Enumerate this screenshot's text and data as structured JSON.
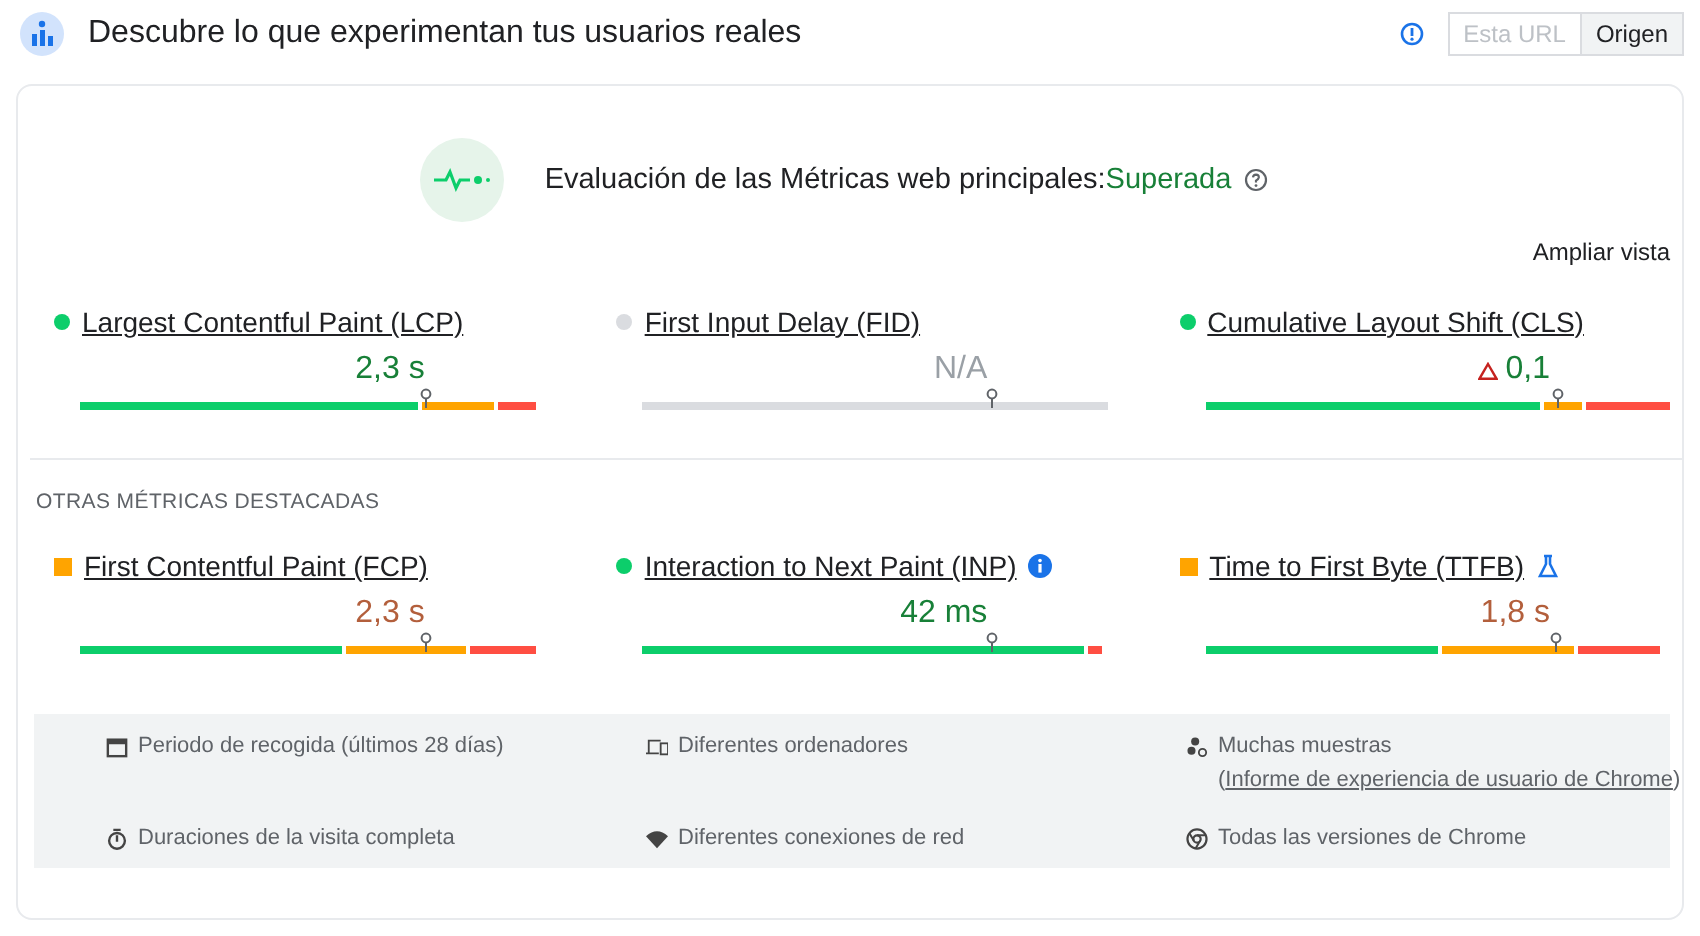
{
  "header": {
    "title": "Descubre lo que experimentan tus usuarios reales",
    "toggle": [
      {
        "label": "Esta URL",
        "selected": false
      },
      {
        "label": "Origen",
        "selected": true
      }
    ]
  },
  "assessment": {
    "label": "Evaluación de las Métricas web principales:",
    "result": "Superada",
    "expand": "Ampliar vista"
  },
  "core_metrics": [
    {
      "name": "Largest Contentful Paint (LCP)",
      "kind": "good",
      "color": "#0cce6b",
      "value": "2,3 s"
    },
    {
      "name": "First Input Delay (FID)",
      "kind": "none",
      "color": "#dadce0",
      "value": "N/A"
    },
    {
      "name": "Cumulative Layout Shift (CLS)",
      "kind": "good",
      "color": "#0cce6b",
      "value": "0,1",
      "warning": true
    }
  ],
  "other_title": "OTRAS MÉTRICAS DESTACADAS",
  "other_metrics": [
    {
      "name": "First Contentful Paint (FCP)",
      "kind": "ni",
      "color": "#ffa400",
      "value": "2,3 s"
    },
    {
      "name": "Interaction to Next Paint (INP)",
      "kind": "good",
      "color": "#0cce6b",
      "value": "42 ms",
      "badge": {
        "kind": "info"
      }
    },
    {
      "name": "Time to First Byte (TTFB)",
      "kind": "ni",
      "color": "#ffa400",
      "value": "1,8 s",
      "badge": {
        "kind": "lab"
      }
    }
  ],
  "footer": [
    {
      "kind": "calendar",
      "text": "Periodo de recogida (últimos 28 días)"
    },
    {
      "kind": "devices",
      "text": "Diferentes ordenadores"
    },
    {
      "kind": "samples",
      "text": "Muchas muestras (",
      "link": "Informe de experiencia de usuario de Chrome",
      "after": ")"
    },
    {
      "kind": "timer",
      "text": "Duraciones de la visita completa"
    },
    {
      "kind": "wifi",
      "text": "Diferentes conexiones de red"
    },
    {
      "kind": "chrome",
      "text": "Todas las versiones de Chrome"
    }
  ]
}
